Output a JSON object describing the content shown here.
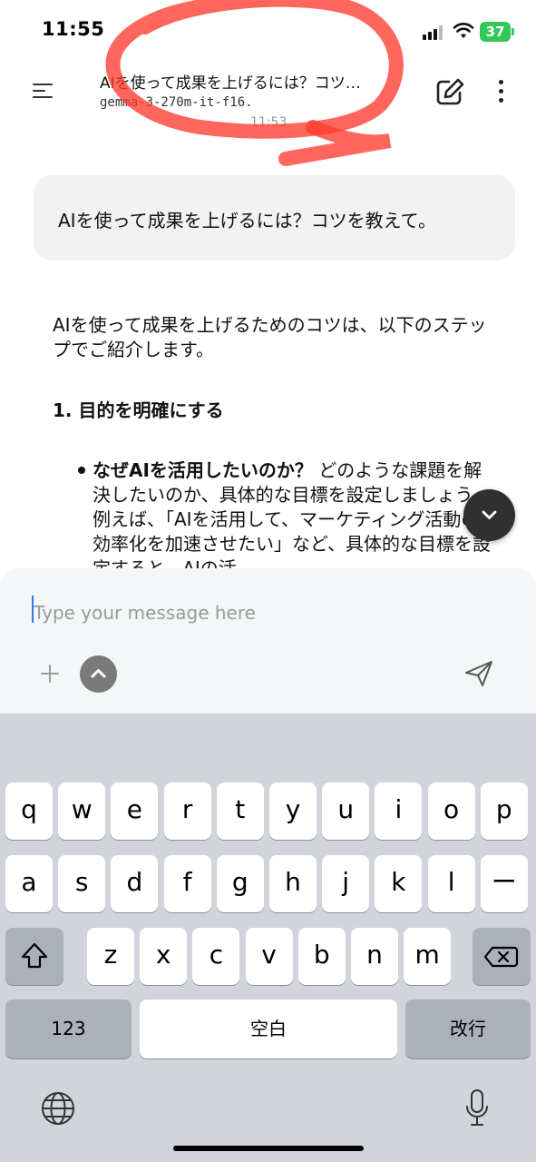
{
  "status_bar": {
    "time": "11:55",
    "battery": "37"
  },
  "header": {
    "title": "AIを使って成果を上げるには？コツ…",
    "model": "gemma-3-270m-it-f16.",
    "time_faded": "11:53"
  },
  "conversation": {
    "user_message": "AIを使って成果を上げるには？コツを教えて。",
    "assistant_intro": "AIを使って成果を上げるためのコツは、以下のステップでご紹介します。",
    "section_heading": "1. 目的を明確にする",
    "bullet_bold": "なぜAIを活用したいのか？",
    "bullet_text": " どのような課題を解決したいのか、具体的な目標を設定しましょう。例えば、「AIを活用して、マーケティング活動の効率化を加速させたい」など、具体的な目標を設定すると、AIの活"
  },
  "composer": {
    "placeholder": "Type your message here"
  },
  "keyboard": {
    "row1": [
      "q",
      "w",
      "e",
      "r",
      "t",
      "y",
      "u",
      "i",
      "o",
      "p"
    ],
    "row2": [
      "a",
      "s",
      "d",
      "f",
      "g",
      "h",
      "j",
      "k",
      "l",
      "ー"
    ],
    "row3": [
      "z",
      "x",
      "c",
      "v",
      "b",
      "n",
      "m"
    ],
    "numbers_label": "123",
    "space_label": "空白",
    "return_label": "改行"
  },
  "icons": {
    "menu": "menu-icon",
    "edit": "edit-icon",
    "more": "more-vertical-icon",
    "scroll_down": "chevron-down-icon",
    "add": "plus-icon",
    "expand": "chevron-up-icon",
    "send": "send-icon",
    "shift": "shift-icon",
    "delete": "backspace-icon",
    "globe": "globe-icon",
    "mic": "microphone-icon"
  },
  "colors": {
    "battery": "#35c759",
    "annotation": "#ff3b30",
    "caret": "#3478f6"
  }
}
